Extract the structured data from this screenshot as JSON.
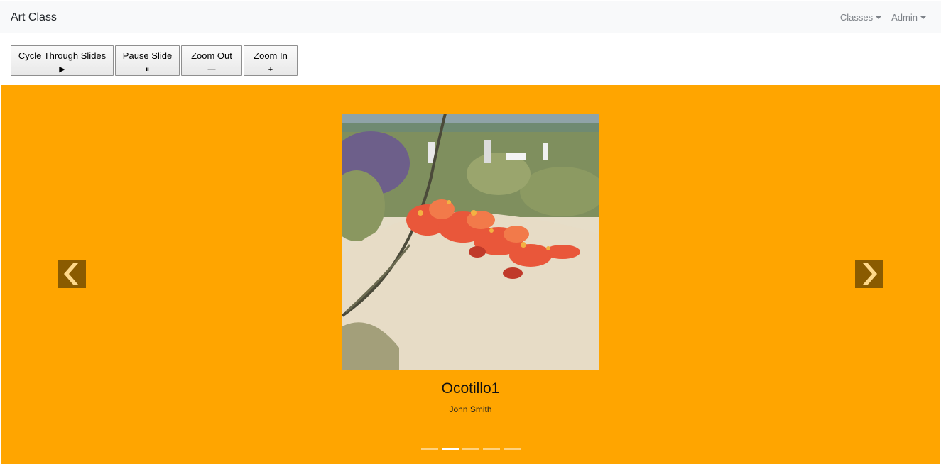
{
  "navbar": {
    "brand": "Art Class",
    "menus": [
      {
        "label": "Classes"
      },
      {
        "label": "Admin"
      }
    ]
  },
  "toolbar": {
    "buttons": [
      {
        "label": "Cycle Through Slides",
        "symbol": "▶"
      },
      {
        "label": "Pause Slide",
        "symbol": "⏸"
      },
      {
        "label": "Zoom Out",
        "symbol": "—"
      },
      {
        "label": "Zoom In",
        "symbol": "+"
      }
    ]
  },
  "carousel": {
    "background_color": "#ffa500",
    "slide": {
      "title": "Ocotillo1",
      "artist": "John Smith"
    },
    "indicators": {
      "count": 5,
      "active_index": 1
    },
    "prev_icon": "chevron-left-icon",
    "next_icon": "chevron-right-icon"
  }
}
